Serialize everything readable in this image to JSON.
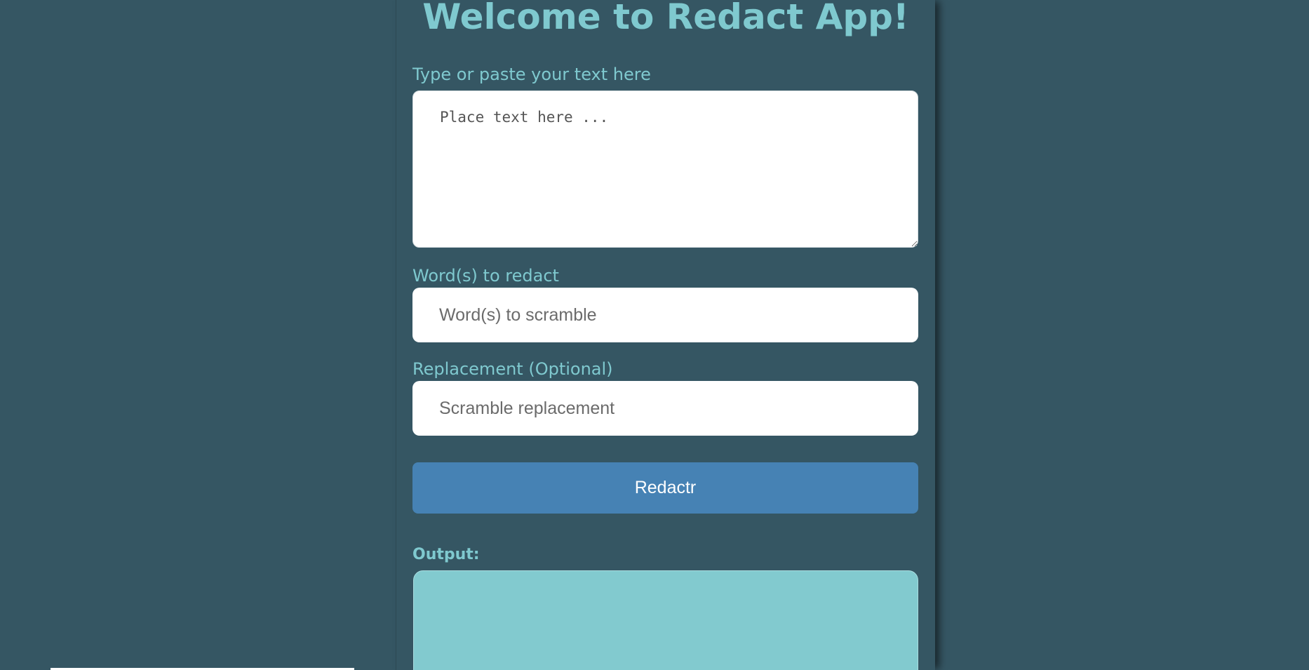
{
  "page": {
    "title": "Welcome to Redact App!"
  },
  "form": {
    "text_label": "Type or paste your text here",
    "text_placeholder": "Place text here ...",
    "text_value": "",
    "words_label": "Word(s) to redact",
    "words_placeholder": "Word(s) to scramble",
    "words_value": "",
    "replacement_label": "Replacement (Optional)",
    "replacement_placeholder": "Scramble replacement",
    "replacement_value": "",
    "submit_label": "Redactr"
  },
  "output": {
    "label": "Output:",
    "value": ""
  },
  "colors": {
    "background": "#355663",
    "accent_text": "#7fc9cf",
    "button": "#4682b4",
    "output_box": "#82cacf"
  }
}
